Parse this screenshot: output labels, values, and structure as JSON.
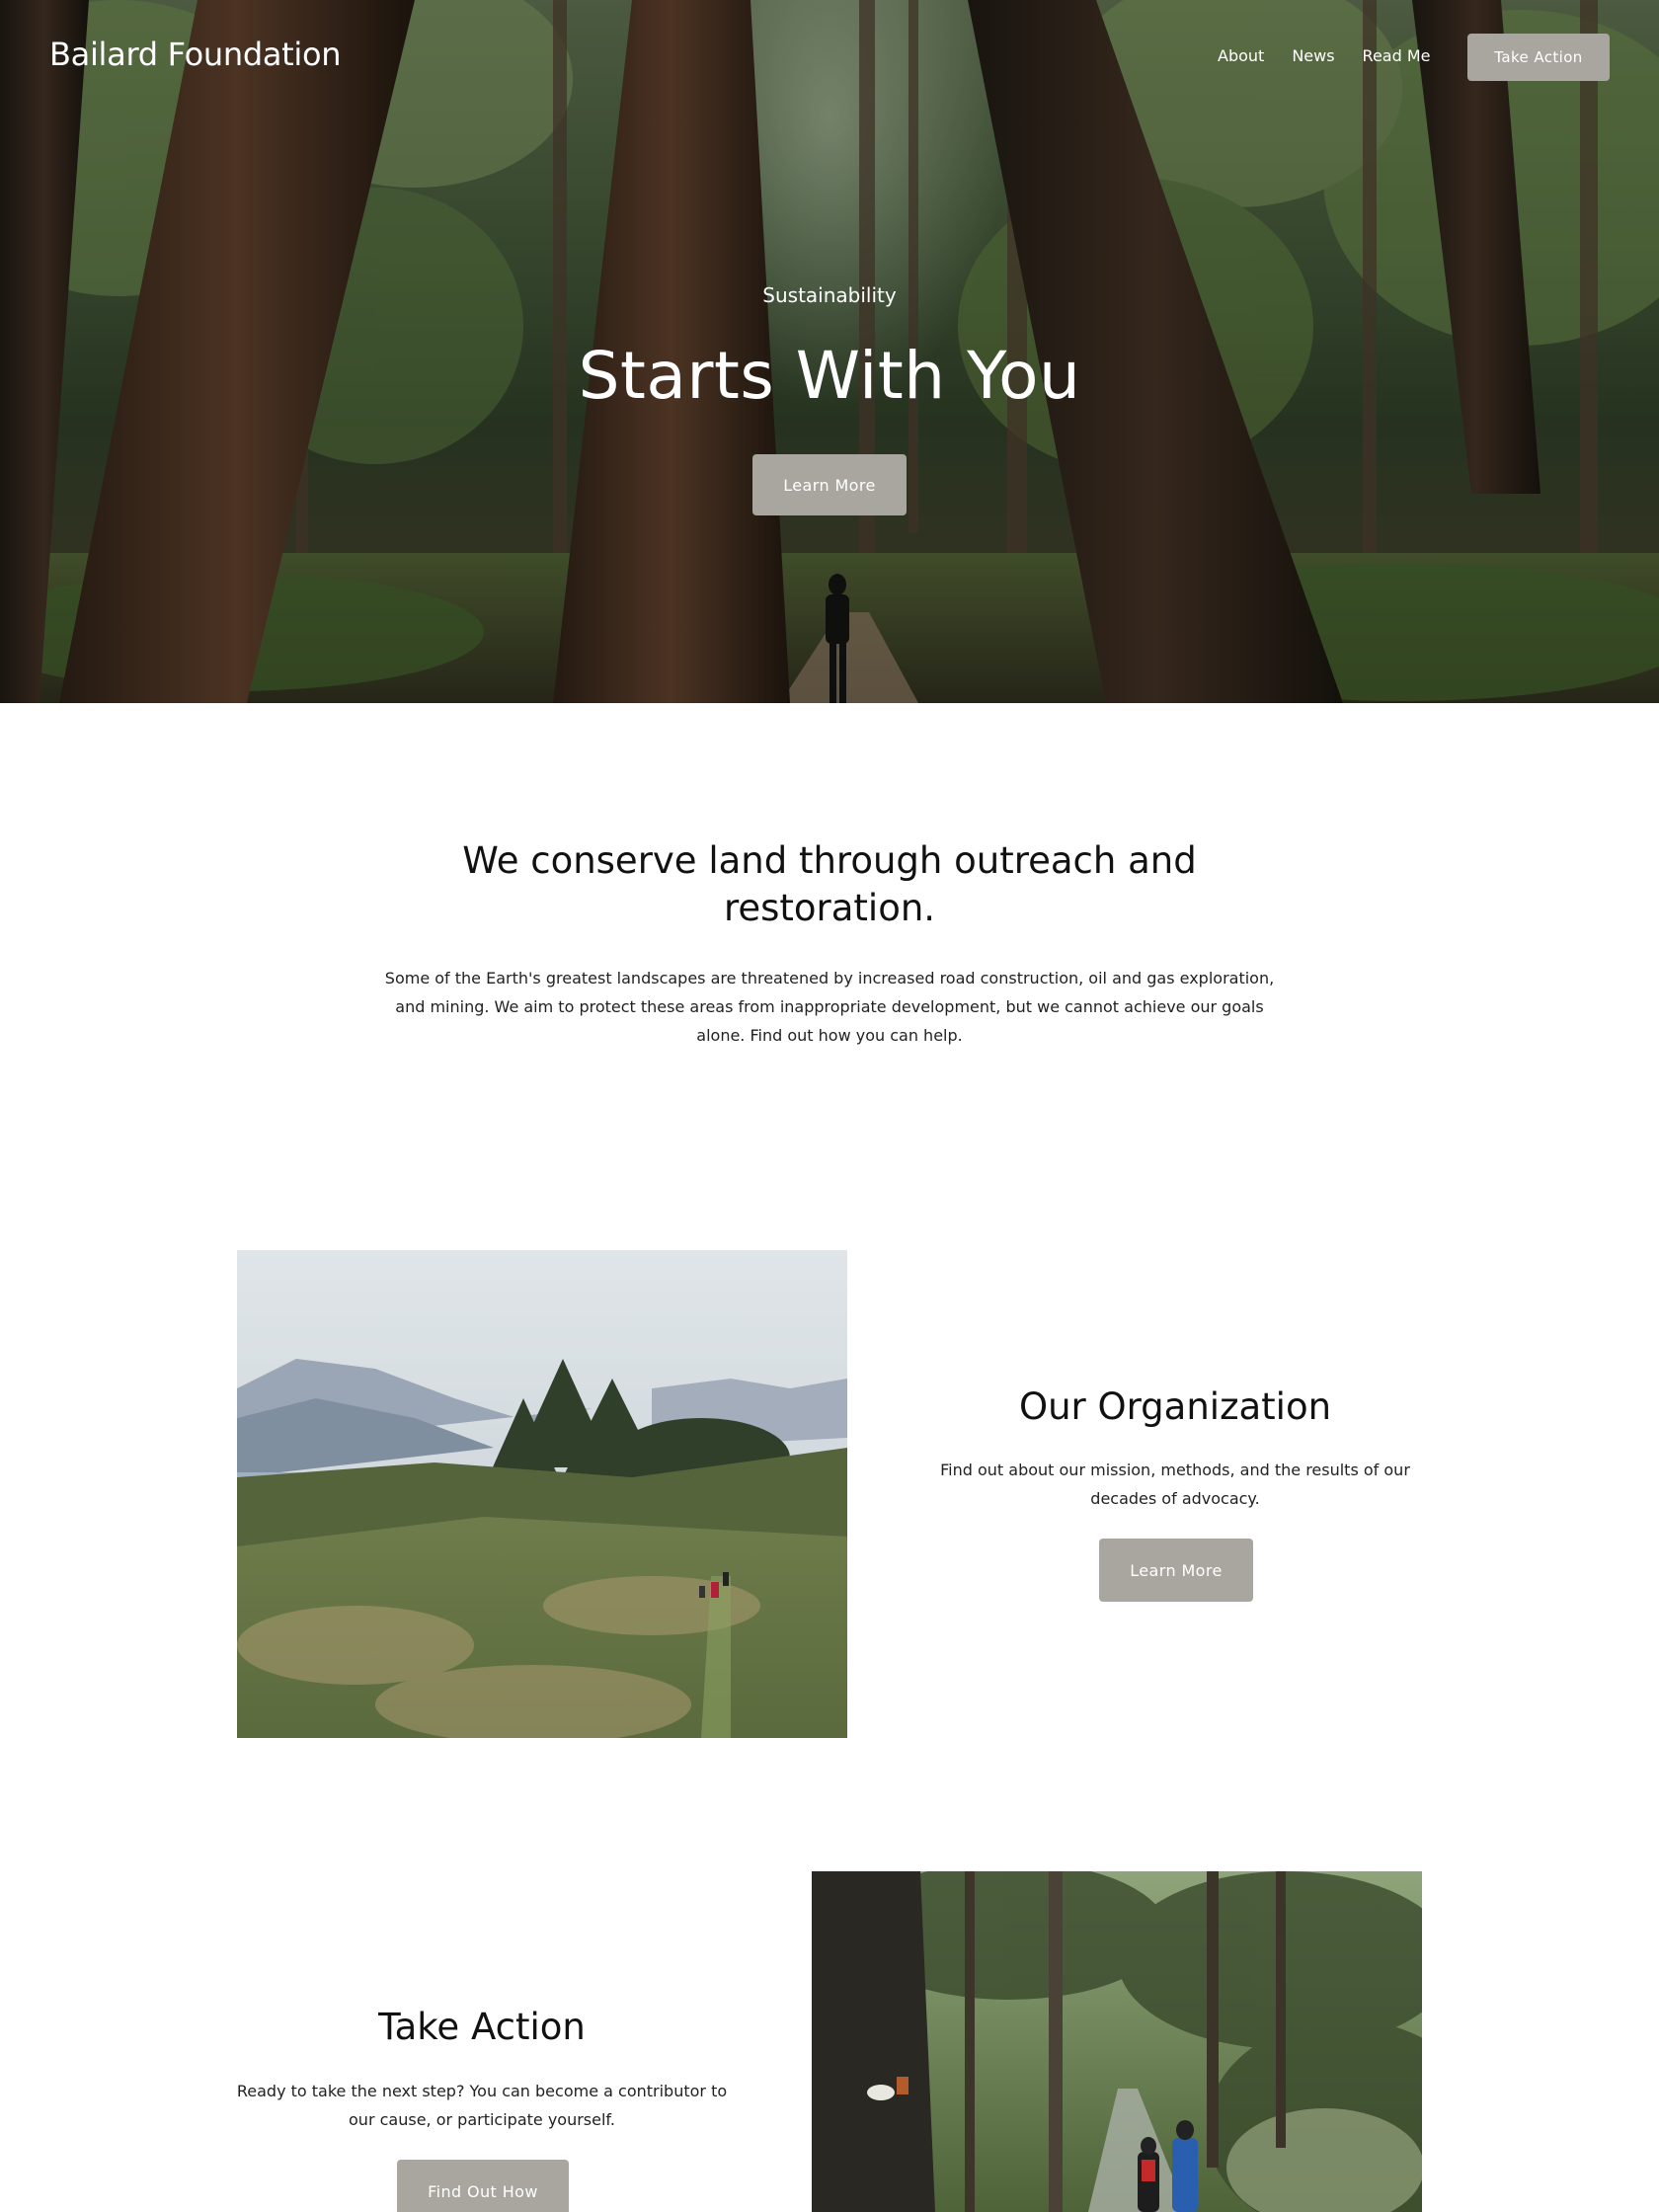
{
  "header": {
    "site_title": "Bailard Foundation",
    "nav": [
      "About",
      "News",
      "Read Me"
    ],
    "cta_label": "Take Action"
  },
  "hero": {
    "kicker": "Sustainability",
    "title": "Starts With You",
    "button_label": "Learn More"
  },
  "intro": {
    "heading": "We conserve land through outreach and restoration.",
    "text": "Some of the Earth's greatest landscapes are threatened by increased road construction, oil and gas exploration, and mining. We aim to protect these areas from inappropriate development, but we cannot achieve our goals alone. Find out how you can help."
  },
  "organization": {
    "title": "Our Organization",
    "text": "Find out about our mission, methods, and the results of our decades of advocacy.",
    "button_label": "Learn More"
  },
  "take_action": {
    "title": "Take Action",
    "text": "Ready to take the next step? You can become a contributor to our cause, or participate yourself.",
    "button_label": "Find Out How"
  },
  "colors": {
    "button": "#a8a69f",
    "text": "#111111",
    "background": "#ffffff"
  }
}
